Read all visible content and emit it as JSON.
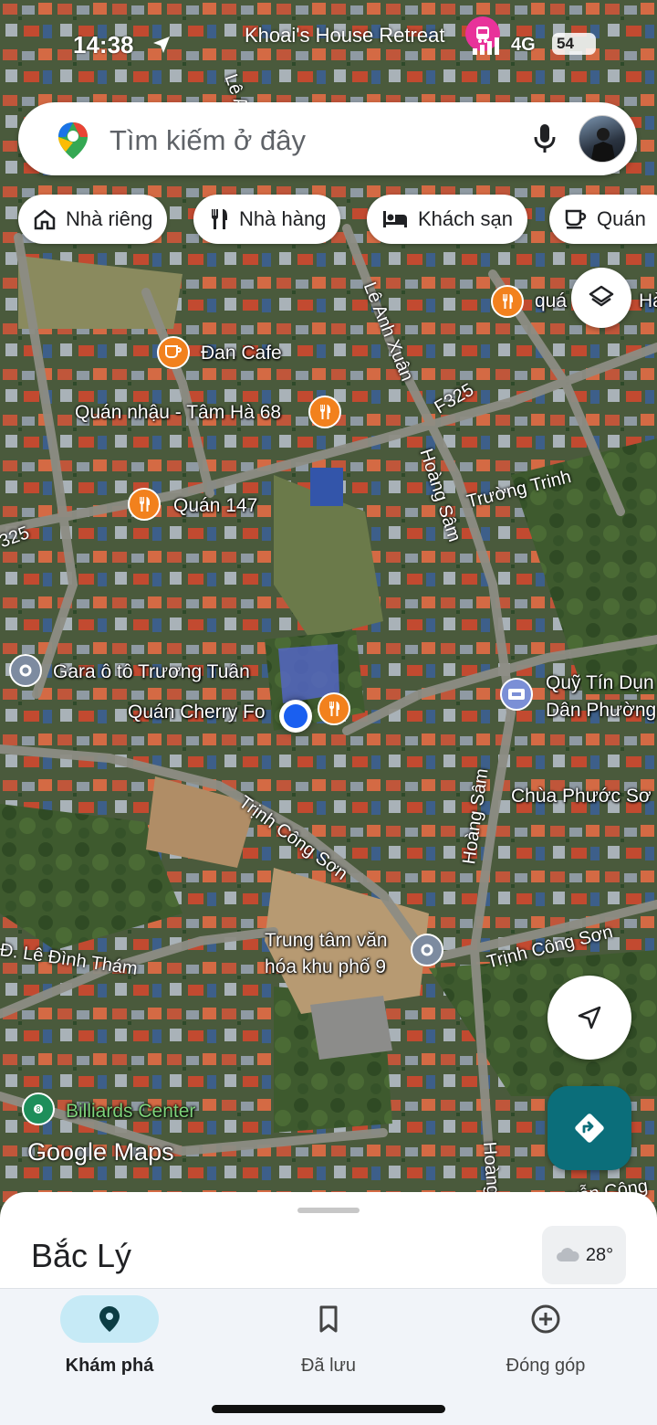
{
  "status_bar": {
    "time": "14:38",
    "app_text": "Khoai's House Retreat",
    "network": "4G",
    "battery": "54"
  },
  "search": {
    "placeholder": "Tìm kiếm ở đây"
  },
  "chips": [
    {
      "label": "Nhà riêng",
      "icon": "home-icon"
    },
    {
      "label": "Nhà hàng",
      "icon": "fork-knife-icon"
    },
    {
      "label": "Khách sạn",
      "icon": "bed-icon"
    },
    {
      "label": "Quán",
      "icon": "coffee-cup-icon"
    }
  ],
  "map": {
    "places": {
      "qua_ha": "quá",
      "ha": "Hà",
      "dan_cafe": "Đan Cafe",
      "quan_nhau": "Quán nhậu - Tâm Hà 68",
      "quan_147": "Quán 147",
      "gara": "Gara ô tô Trương Tuân",
      "cherry": "Quán Cherry Fo",
      "quy_tin_dung_1": "Quỹ Tín Dụn",
      "quy_tin_dung_2": "Dân Phường",
      "chua": "Chùa Phước Sơ",
      "trung_tam_1": "Trung tâm văn",
      "trung_tam_2": "hóa khu phố 9",
      "billiards": "Billiards Center"
    },
    "streets": {
      "le_anh_xuan": "Lê Anh Xuân",
      "le_a": "Lê A",
      "f325_a": "F325",
      "f325_b": "F325",
      "f325_c": "325",
      "hoang_sam_1": "Hoàng Sâm",
      "hoang_sam_2": "Hoàng Sâm",
      "hoang_3": "Hoàng",
      "truong_trinh": "Trường Trinh",
      "trinh_cong_son_1": "Trịnh Công Sơn",
      "trinh_cong_son_2": "Trịnh Công Sơn",
      "le_dinh_tham": "Đ. Lê Đình Thám",
      "nguyen_cong": "uyễn Công"
    },
    "logo": "Google Maps"
  },
  "sheet": {
    "place_name": "Bắc Lý",
    "temperature": "28°"
  },
  "nav": [
    {
      "label": "Khám phá",
      "icon": "location-pin-icon",
      "active": true
    },
    {
      "label": "Đã lưu",
      "icon": "bookmark-icon",
      "active": false
    },
    {
      "label": "Đóng góp",
      "icon": "add-circle-icon",
      "active": false
    }
  ],
  "colors": {
    "accent_teal": "#0b6e7a",
    "poi_orange": "#f2811d",
    "location_blue": "#1a5ff0",
    "nav_active_pill": "#c6eaf6"
  }
}
